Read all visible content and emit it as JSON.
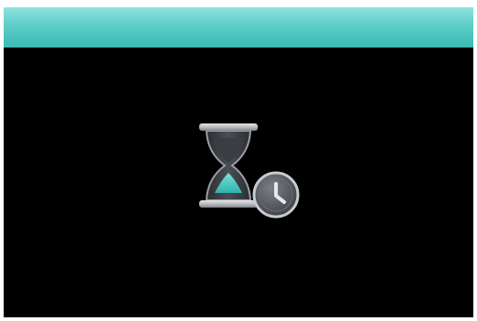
{
  "screen": {
    "header": {
      "title": ""
    },
    "status": {
      "state": "waiting",
      "icons": [
        "hourglass-icon",
        "clock-icon"
      ]
    }
  },
  "colors": {
    "header_top": "#8fe3de",
    "header_bottom": "#3cbab4",
    "background": "#000000",
    "hourglass_sand": "#47c8c2",
    "metal": "#b9bcc0",
    "clock_face": "#5a5d62"
  }
}
